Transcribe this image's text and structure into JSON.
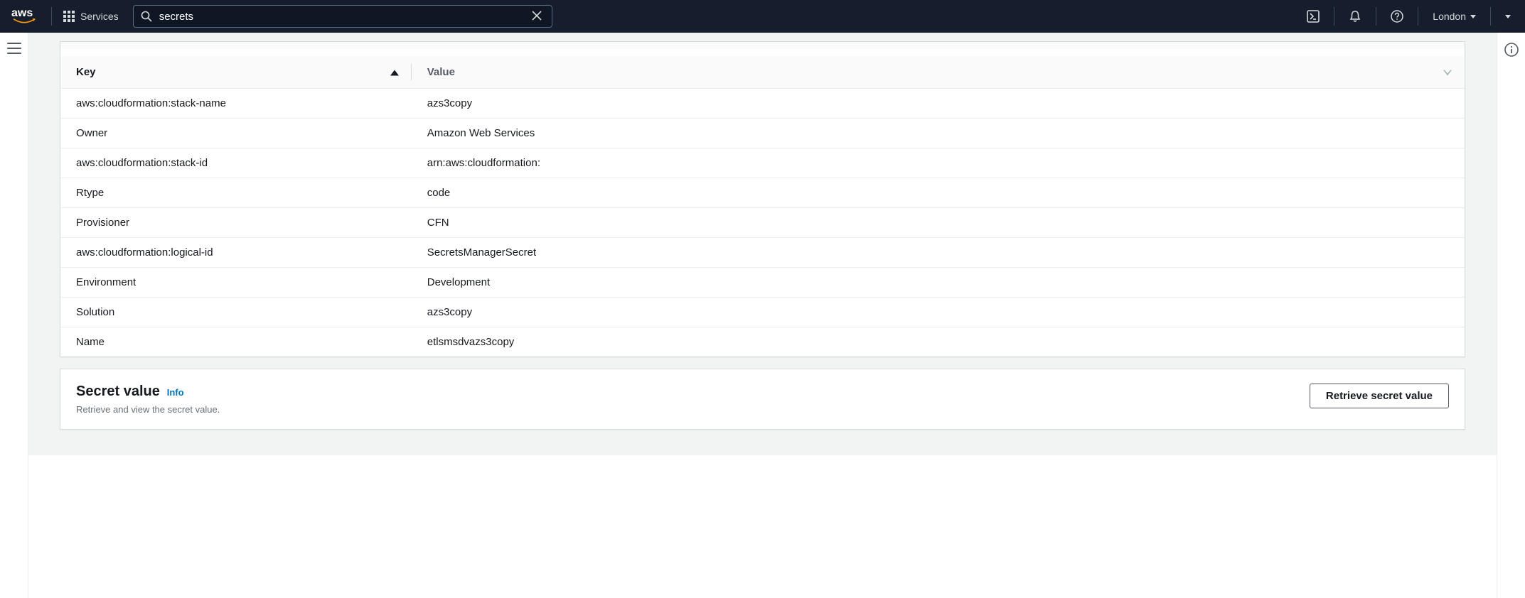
{
  "nav": {
    "services_label": "Services",
    "search_value": "secrets",
    "region": "London"
  },
  "table": {
    "headers": {
      "key": "Key",
      "value": "Value"
    },
    "rows": [
      {
        "key": "aws:cloudformation:stack-name",
        "value": "azs3copy"
      },
      {
        "key": "Owner",
        "value": "Amazon Web Services"
      },
      {
        "key": "aws:cloudformation:stack-id",
        "value": "arn:aws:cloudformation:"
      },
      {
        "key": "Rtype",
        "value": "code"
      },
      {
        "key": "Provisioner",
        "value": "CFN"
      },
      {
        "key": "aws:cloudformation:logical-id",
        "value": "SecretsManagerSecret"
      },
      {
        "key": "Environment",
        "value": "Development"
      },
      {
        "key": "Solution",
        "value": "azs3copy"
      },
      {
        "key": "Name",
        "value": "etlsmsdvazs3copy"
      }
    ]
  },
  "secret_value": {
    "title": "Secret value",
    "info_label": "Info",
    "subtitle": "Retrieve and view the secret value.",
    "retrieve_button": "Retrieve secret value"
  }
}
